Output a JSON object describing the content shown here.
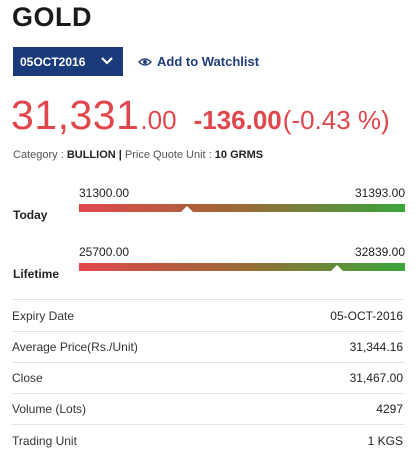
{
  "commodity": {
    "title": "GOLD"
  },
  "expiry_select": {
    "value": "05OCT2016"
  },
  "watchlist": {
    "label": "Add to Watchlist"
  },
  "price": {
    "integer": "31,331",
    "decimal": ".00",
    "change": "-136.00",
    "change_pct": "(-0.43 %)",
    "color": "#e0474c"
  },
  "meta": {
    "category_label": "Category :",
    "category_value": "BULLION",
    "separator": "|",
    "unit_label": "Price Quote Unit :",
    "unit_value": "10 GRMS"
  },
  "ranges": {
    "today": {
      "label": "Today",
      "low": "31300.00",
      "high": "31393.00",
      "position_fraction": 0.33
    },
    "lifetime": {
      "label": "Lifetime",
      "low": "25700.00",
      "high": "32839.00",
      "position_fraction": 0.79
    }
  },
  "details": [
    {
      "key": "Expiry Date",
      "value": "05-OCT-2016"
    },
    {
      "key": "Average Price(Rs./Unit)",
      "value": "31,344.16"
    },
    {
      "key": "Close",
      "value": "31,467.00"
    },
    {
      "key": "Volume (Lots)",
      "value": "4297"
    },
    {
      "key": "Trading Unit",
      "value": "1 KGS"
    }
  ],
  "colors": {
    "brand_navy": "#1a3a7a",
    "accent_red": "#e0474c",
    "accent_green": "#3aa63a"
  }
}
